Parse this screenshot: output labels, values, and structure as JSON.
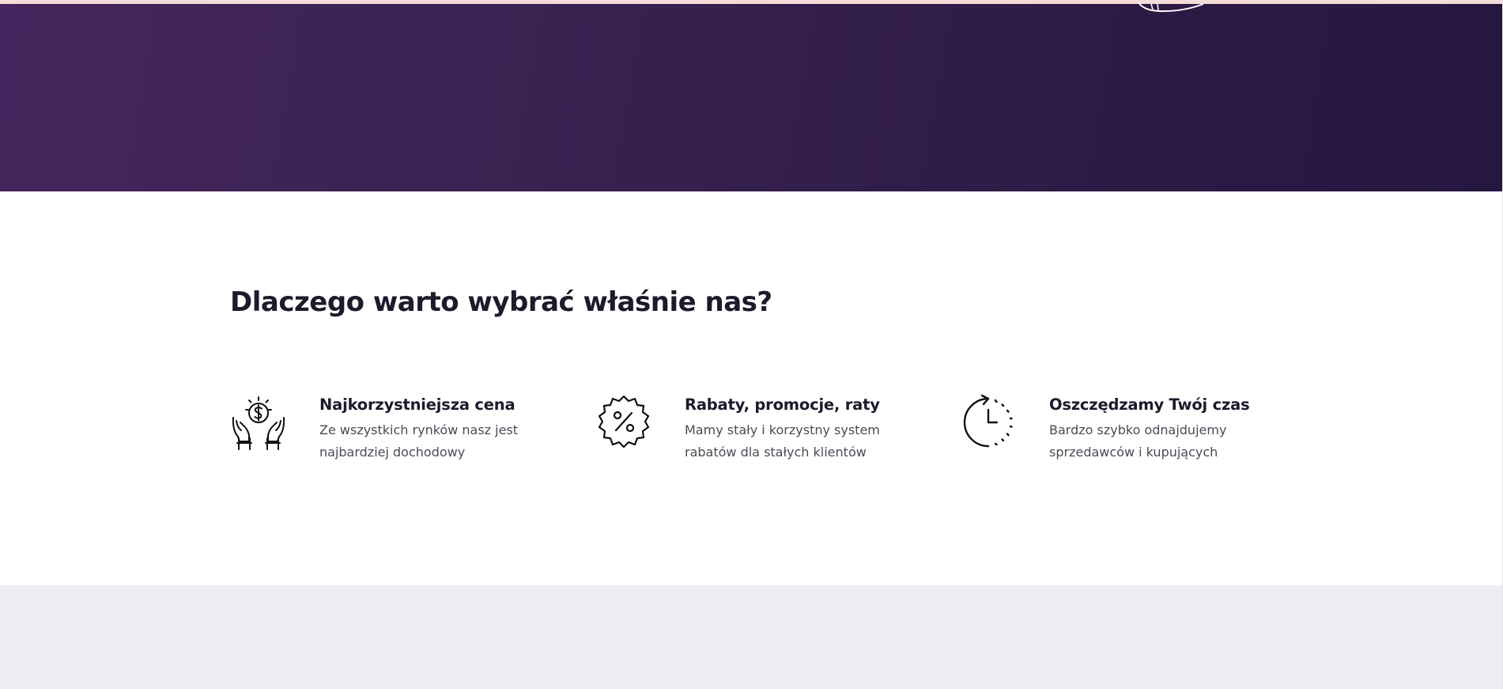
{
  "colors": {
    "hero_gradient_start": "#45265e",
    "hero_gradient_end": "#261741",
    "heading": "#1d1a2c",
    "body_text": "#4d4a55",
    "bottom_section_bg": "#efedf3"
  },
  "why_section": {
    "title": "Dlaczego warto wybrać właśnie nas?",
    "features": [
      {
        "icon": "hands-coin-icon",
        "title": "Najkorzystniejsza cena",
        "description": "Ze wszystkich rynków nasz jest najbardziej dochodowy"
      },
      {
        "icon": "percent-badge-icon",
        "title": "Rabaty, promocje, raty",
        "description": "Mamy stały i korzystny system rabatów dla stałych klientów"
      },
      {
        "icon": "clock-time-icon",
        "title": "Oszczędzamy Twój czas",
        "description": "Bardzo szybko odnajdujemy sprzedawców i kupujących"
      }
    ]
  }
}
